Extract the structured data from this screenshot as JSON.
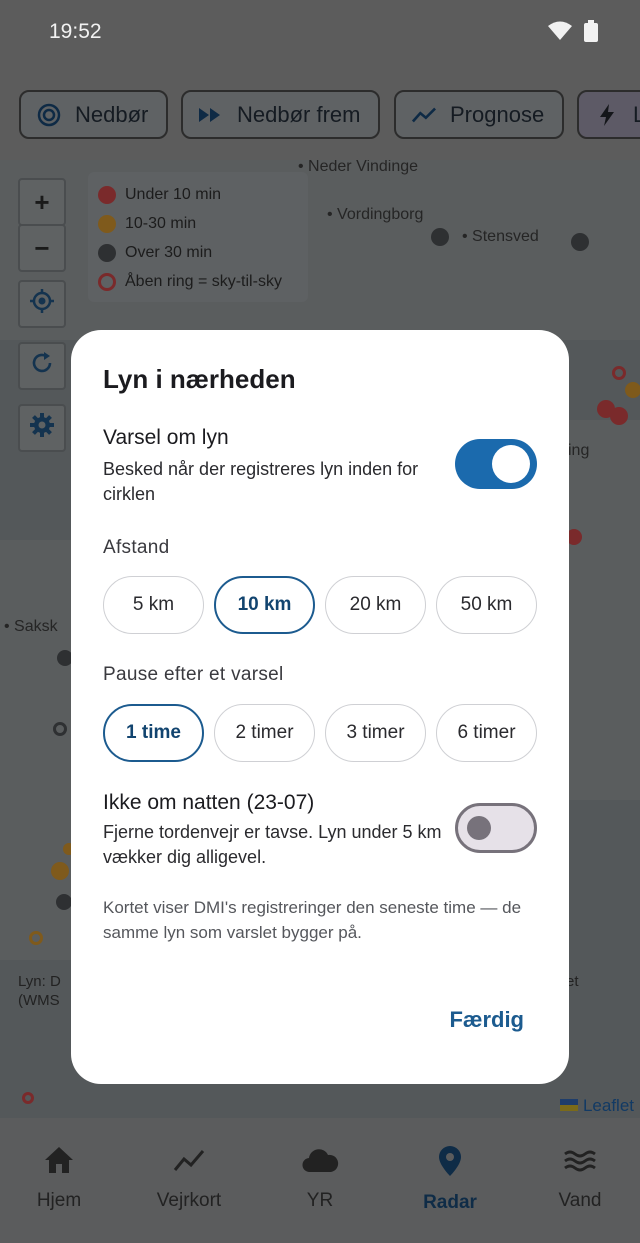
{
  "status_bar": {
    "time": "19:52",
    "icons": [
      "wifi-icon",
      "battery-icon"
    ]
  },
  "chips": [
    {
      "label": "Nedbør",
      "icon": "radar-target-icon"
    },
    {
      "label": "Nedbør frem",
      "icon": "fast-forward-icon"
    },
    {
      "label": "Prognose",
      "icon": "trend-line-icon"
    },
    {
      "label": "L",
      "icon": "lightning-icon"
    }
  ],
  "map": {
    "zoom_in": "+",
    "zoom_out": "−",
    "legend": [
      {
        "label": "Under 10 min",
        "color": "#7a2a2b"
      },
      {
        "label": "10-30 min",
        "color": "#7f5a1c"
      },
      {
        "label": "Over 30 min",
        "color": "#2e3032"
      },
      {
        "label": "Åben ring = sky-til-sky",
        "color": "#7a2a2b"
      }
    ],
    "towns": {
      "neder_vindinge": "Neder Vindinge",
      "vordingborg": "Vordingborg",
      "stensved": "Stensved",
      "saksk": "Saksk",
      "partial_right": "ing"
    },
    "attribution": {
      "line1": "Lyn: D",
      "line2": "(WMS",
      "right": "et"
    },
    "leaflet": "Leaflet"
  },
  "dialog": {
    "title": "Lyn i nærheden",
    "alert": {
      "title": "Varsel om lyn",
      "description": "Besked når der registreres lyn inden for cirklen",
      "enabled": true
    },
    "distance": {
      "label": "Afstand",
      "options": [
        "5 km",
        "10 km",
        "20 km",
        "50 km"
      ],
      "selected": "10 km"
    },
    "pause": {
      "label": "Pause efter et varsel",
      "options": [
        "1 time",
        "2 timer",
        "3 timer",
        "6 timer"
      ],
      "selected": "1 time"
    },
    "night": {
      "title": "Ikke om natten (23-07)",
      "description": "Fjerne tordenvejr er tavse. Lyn under 5 km vækker dig alligevel.",
      "enabled": false
    },
    "footnote": "Kortet viser DMI's registreringer den seneste time — de samme lyn som varslet bygger på.",
    "done_label": "Færdig"
  },
  "bottom_nav": [
    {
      "label": "Hjem",
      "icon": "home-icon",
      "active": false
    },
    {
      "label": "Vejrkort",
      "icon": "chart-line-icon",
      "active": false
    },
    {
      "label": "YR",
      "icon": "cloud-icon",
      "active": false
    },
    {
      "label": "Radar",
      "icon": "location-pin-icon",
      "active": true
    },
    {
      "label": "Vand",
      "icon": "waves-icon",
      "active": false
    }
  ]
}
